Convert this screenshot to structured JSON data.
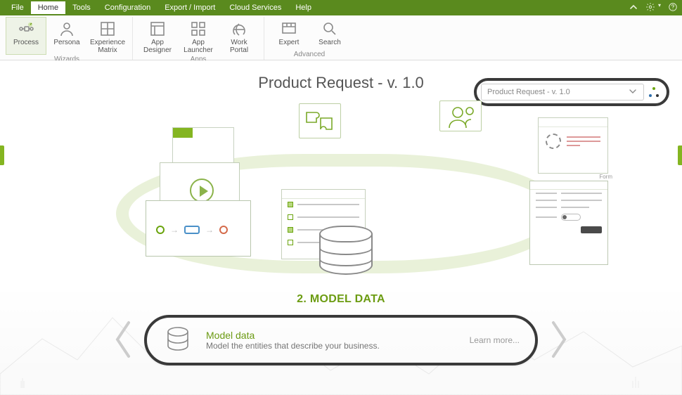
{
  "menubar": {
    "items": [
      "File",
      "Home",
      "Tools",
      "Configuration",
      "Export / Import",
      "Cloud Services",
      "Help"
    ],
    "active_index": 1
  },
  "ribbon": {
    "groups": [
      {
        "label": "Wizards",
        "buttons": [
          {
            "name": "process",
            "label": "Process",
            "active": true
          },
          {
            "name": "persona",
            "label": "Persona"
          },
          {
            "name": "experience-matrix",
            "label": "Experience\nMatrix"
          }
        ]
      },
      {
        "label": "Apps",
        "buttons": [
          {
            "name": "app-designer",
            "label": "App Designer"
          },
          {
            "name": "app-launcher",
            "label": "App Launcher"
          },
          {
            "name": "work-portal",
            "label": "Work Portal"
          }
        ]
      },
      {
        "label": "Advanced",
        "buttons": [
          {
            "name": "expert",
            "label": "Expert"
          },
          {
            "name": "search",
            "label": "Search"
          }
        ]
      }
    ]
  },
  "page": {
    "title": "Product Request - v. 1.0",
    "dropdown_value": "Product Request - v. 1.0",
    "form_card_label": "Form"
  },
  "step": {
    "title": "2. MODEL DATA",
    "card_title": "Model data",
    "card_subtitle": "Model the entities that describe your business.",
    "learn_more": "Learn more..."
  },
  "colors": {
    "brand_green": "#6c9c12",
    "ribbon_green": "#5a8a1e",
    "highlight_border": "#3a3a3a"
  }
}
